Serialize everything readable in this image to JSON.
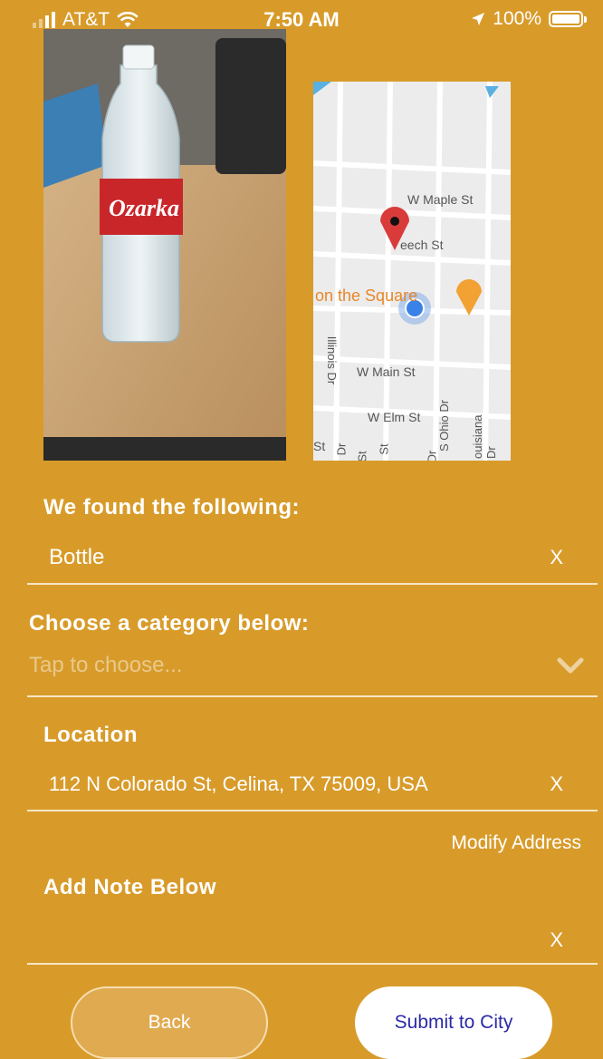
{
  "status_bar": {
    "carrier": "AT&T",
    "time": "7:50 AM",
    "battery": "100%"
  },
  "map": {
    "streets": [
      "W Maple St",
      "eech St",
      "W Main St",
      "W Elm St",
      "Illinois Dr",
      "S Ohio Dr",
      "ouisiana Dr",
      "St",
      "St",
      "Dr",
      "St",
      "Dr"
    ],
    "poi_label": "on the Square"
  },
  "found": {
    "heading": "We found the following:",
    "value": "Bottle",
    "clear": "X"
  },
  "category": {
    "heading": "Choose a category below:",
    "placeholder": "Tap to choose..."
  },
  "location": {
    "heading": "Location",
    "value": "112 N Colorado St, Celina, TX 75009, USA",
    "clear": "X",
    "modify_label": "Modify Address"
  },
  "note": {
    "heading": "Add Note Below",
    "value": "",
    "clear": "X"
  },
  "buttons": {
    "back": "Back",
    "submit": "Submit to City"
  },
  "colors": {
    "background": "#D89B2A",
    "submit_text": "#2a2aa8"
  }
}
